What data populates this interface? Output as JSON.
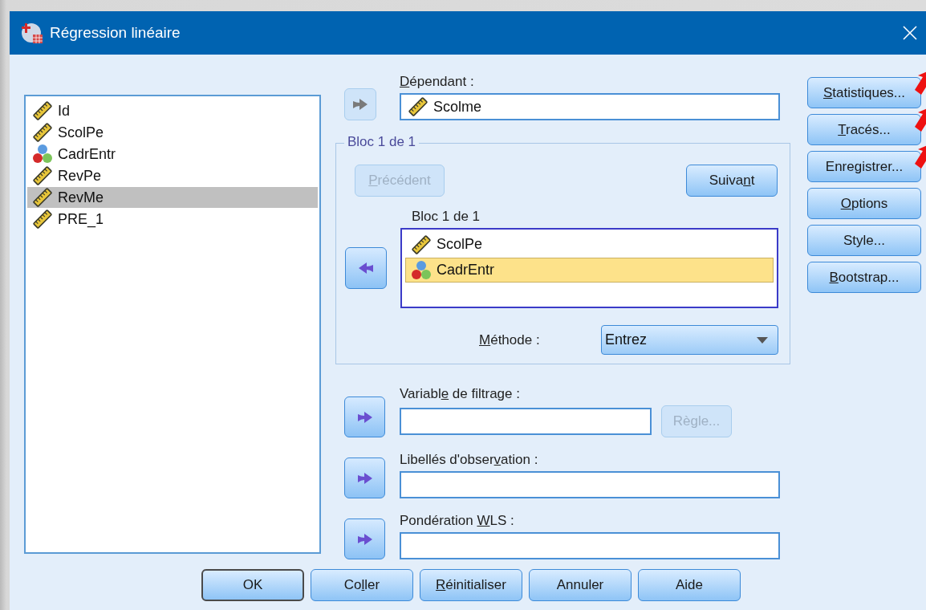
{
  "window": {
    "title": "Régression linéaire"
  },
  "variables": [
    {
      "name": "Id",
      "kind": "scale",
      "selected": false
    },
    {
      "name": "ScolPe",
      "kind": "scale",
      "selected": false
    },
    {
      "name": "CadrEntr",
      "kind": "nominal",
      "selected": false
    },
    {
      "name": "RevPe",
      "kind": "scale",
      "selected": false
    },
    {
      "name": "RevMe",
      "kind": "scale",
      "selected": true
    },
    {
      "name": "PRE_1",
      "kind": "scale",
      "selected": false
    }
  ],
  "dependent": {
    "label": {
      "key": "D",
      "after": "épendant :"
    },
    "arrow": {
      "kind": "right",
      "disabled": true
    },
    "value": {
      "name": "Scolme",
      "kind": "scale"
    }
  },
  "block": {
    "title": "Bloc 1 de 1",
    "previous": {
      "label": {
        "key": "P",
        "after": "récédent"
      },
      "disabled": true
    },
    "next": {
      "label": {
        "before": "Suiva",
        "key": "n",
        "after": "t"
      },
      "disabled": false
    },
    "list_title": "Bloc 1 de 1",
    "arrow": {
      "kind": "left",
      "disabled": false
    },
    "independents": [
      {
        "name": "ScolPe",
        "kind": "scale",
        "selected": false
      },
      {
        "name": "CadrEntr",
        "kind": "nominal",
        "selected": true
      }
    ],
    "method": {
      "label": {
        "key": "M",
        "after": "éthode :"
      },
      "value": "Entrez"
    }
  },
  "filter": {
    "label": {
      "before": "Variabl",
      "key": "e",
      "after": " de filtrage :"
    },
    "arrow": {
      "kind": "right",
      "disabled": false
    },
    "rule_button": {
      "label": {
        "before": "Règle..."
      },
      "disabled": true
    }
  },
  "case_labels": {
    "label": {
      "before": "Libellés d'obser",
      "key": "v",
      "after": "ation :"
    },
    "arrow": {
      "kind": "right",
      "disabled": false
    }
  },
  "wls": {
    "label": {
      "before": "Pondération ",
      "key": "W",
      "after": "LS :"
    },
    "arrow": {
      "kind": "right",
      "disabled": false
    }
  },
  "side_buttons": [
    {
      "label": {
        "key": "S",
        "after": "tatistiques..."
      },
      "annotated": true
    },
    {
      "label": {
        "key": "T",
        "after": "racés..."
      },
      "annotated": true
    },
    {
      "label": {
        "before": "Enregistrer..."
      },
      "annotated": true
    },
    {
      "label": {
        "key": "O",
        "after": "ptions"
      },
      "annotated": false
    },
    {
      "label": {
        "before": "Style..."
      },
      "annotated": false
    },
    {
      "label": {
        "key": "B",
        "after": "ootstrap..."
      },
      "annotated": false
    }
  ],
  "footer_buttons": [
    {
      "label": {
        "before": "OK"
      },
      "default": true
    },
    {
      "label": {
        "before": "Co",
        "key": "l",
        "after": "ler"
      },
      "default": false
    },
    {
      "label": {
        "key": "R",
        "after": "éinitialiser"
      },
      "default": false
    },
    {
      "label": {
        "before": "Annuler"
      },
      "default": false
    },
    {
      "label": {
        "before": "Aide"
      },
      "default": false
    }
  ]
}
